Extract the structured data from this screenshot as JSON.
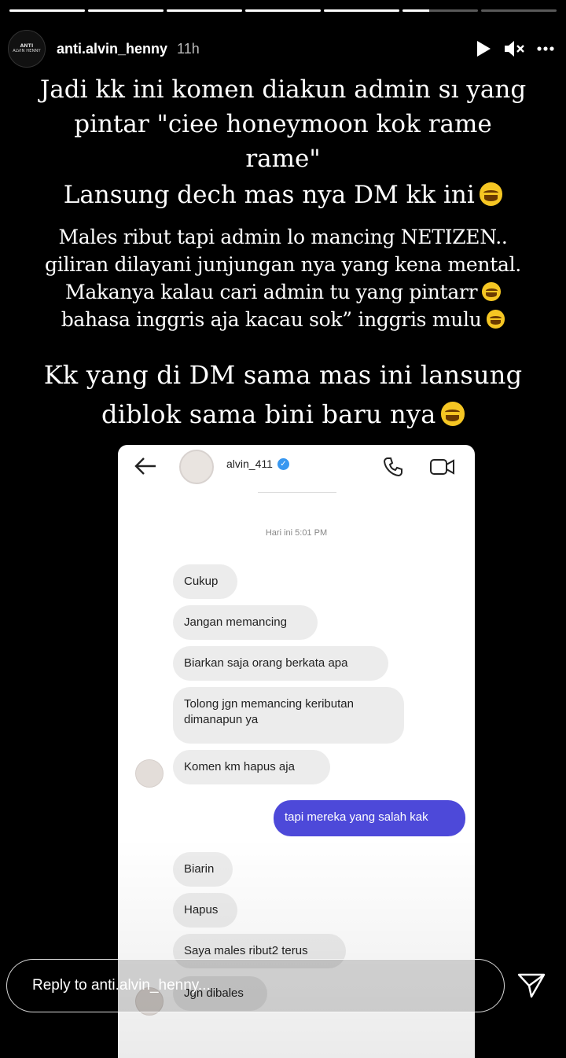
{
  "story": {
    "progress_fractions": [
      1,
      1,
      1,
      1,
      1,
      0.35,
      0
    ],
    "account": {
      "username": "anti.alvin_henny",
      "time": "11h",
      "avatar_text_top": "ANTI",
      "avatar_text_bottom": "ALVIN HENNY"
    },
    "controls": {
      "play_icon": "play-icon",
      "mute_icon": "speaker-muted-icon",
      "more_icon": "more-icon"
    },
    "text_block_1": [
      "Jadi kk ini komen diakun admin sı yang",
      "pintar  \"ciee honeymoon kok rame",
      "rame\"",
      "Lansung dech mas nya DM kk ini"
    ],
    "text_block_2": [
      "Males ribut tapi admin lo mancing NETIZEN..",
      "giliran dilayani junjungan nya yang kena mental.",
      "Makanya kalau cari admin tu yang pintarr",
      "bahasa inggris aja kacau sok” inggris mulu"
    ],
    "text_block_3": [
      "Kk yang di DM sama mas ini lansung",
      "diblok sama bini baru nya"
    ],
    "emoji_color": "#f5c623"
  },
  "dm_screenshot": {
    "username": "alvin_411",
    "date_label": "Hari ini 5:01 PM",
    "messages": [
      {
        "text": "Cukup",
        "dir": "in"
      },
      {
        "text": "Jangan memancing",
        "dir": "in"
      },
      {
        "text": "Biarkan saja orang berkata apa",
        "dir": "in"
      },
      {
        "text": "Tolong jgn memancing keributan dimanapun ya",
        "dir": "in"
      },
      {
        "text": "Komen km hapus aja",
        "dir": "in"
      },
      {
        "text": "tapi mereka yang salah kak",
        "dir": "out"
      },
      {
        "text": "Biarin",
        "dir": "in"
      },
      {
        "text": "Hapus",
        "dir": "in"
      },
      {
        "text": "Saya males ribut2 terus",
        "dir": "in"
      },
      {
        "text": "Jgn dibales",
        "dir": "in"
      }
    ],
    "outgoing_color": "#4d49d9"
  },
  "reply_bar": {
    "placeholder": "Reply to anti.alvin_henny..."
  }
}
